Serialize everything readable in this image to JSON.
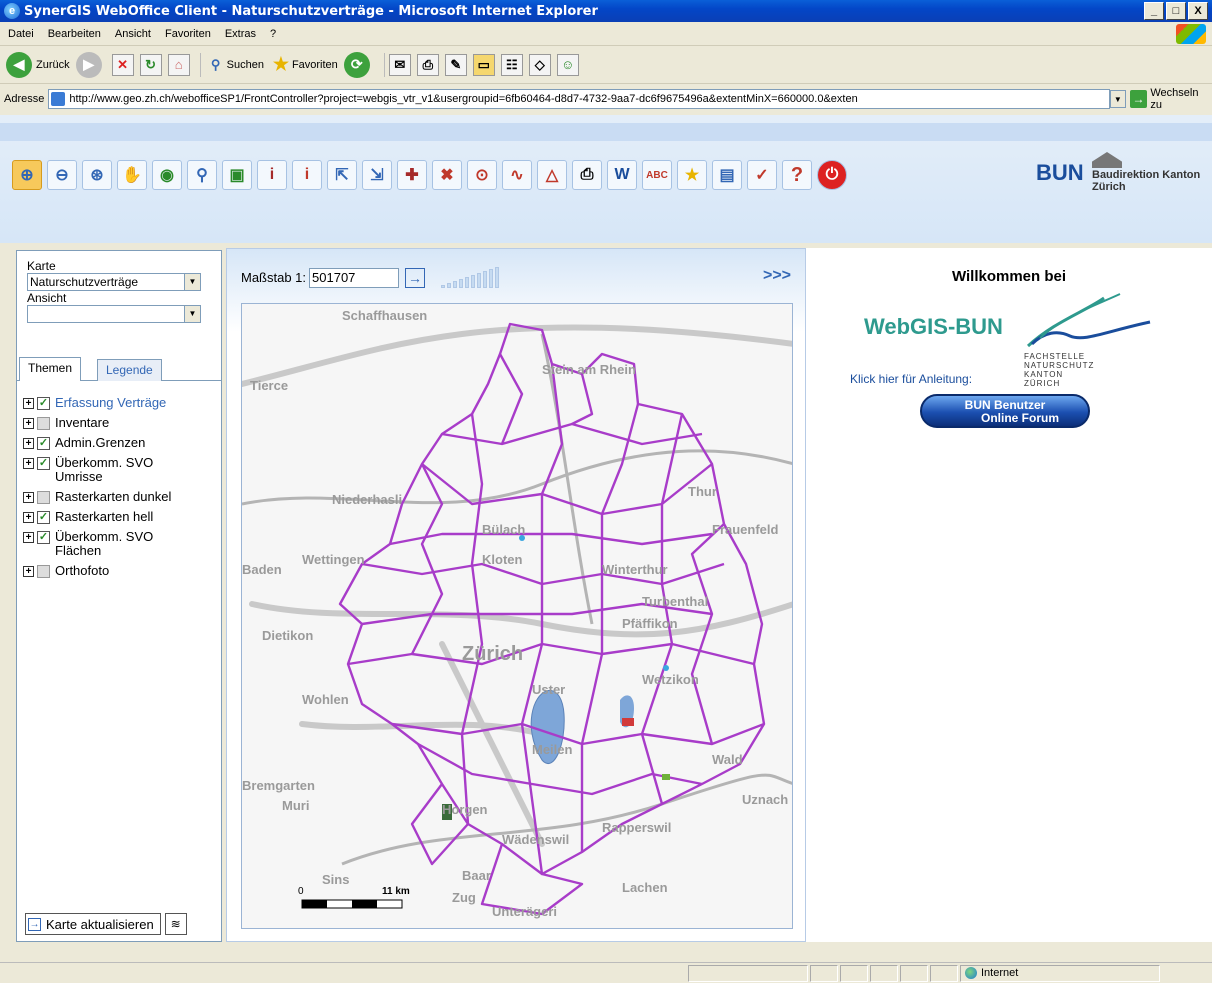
{
  "window": {
    "title": "SynerGIS WebOffice Client - Naturschutzverträge - Microsoft Internet Explorer",
    "min": "_",
    "max": "□",
    "close": "X"
  },
  "menu": [
    "Datei",
    "Bearbeiten",
    "Ansicht",
    "Favoriten",
    "Extras",
    "?"
  ],
  "toolbar": {
    "back": "Zurück",
    "search": "Suchen",
    "favorites": "Favoriten"
  },
  "address": {
    "label": "Adresse",
    "url": "http://www.geo.zh.ch/webofficeSP1/FrontController?project=webgis_vtr_v1&usergroupid=6fb60464-d8d7-4732-9aa7-dc6f9675496a&extentMinX=660000.0&exten",
    "go": "Wechseln zu"
  },
  "app": {
    "bun": "BUN",
    "baudirektion": "Baudirektion Kanton Zürich"
  },
  "left": {
    "karte_label": "Karte",
    "karte_value": "Naturschutzverträge",
    "ansicht_label": "Ansicht",
    "ansicht_value": "",
    "tab_themen": "Themen",
    "tab_legende": "Legende",
    "themes": [
      {
        "label": "Erfassung Verträge",
        "checked": true
      },
      {
        "label": "Inventare",
        "checked": false
      },
      {
        "label": "Admin.Grenzen",
        "checked": true
      },
      {
        "label": "Überkomm. SVO Umrisse",
        "checked": true
      },
      {
        "label": "Rasterkarten dunkel",
        "checked": false
      },
      {
        "label": "Rasterkarten hell",
        "checked": true
      },
      {
        "label": "Überkomm. SVO Flächen",
        "checked": true
      },
      {
        "label": "Orthofoto",
        "checked": false
      }
    ],
    "refresh": "Karte aktualisieren"
  },
  "map": {
    "scale_label": "Maßstab 1:",
    "scale_value": "501707",
    "more": ">>>",
    "places": [
      "Schaffhausen",
      "Stein am Rhein",
      "Tierce",
      "Frauenfeld",
      "Niederhasli",
      "Bülach",
      "Winterthur",
      "Baden",
      "Wettingen",
      "Kloten",
      "Dietikon",
      "Zürich",
      "Wohlen",
      "Uster",
      "Wetzikon",
      "Meilen",
      "Bremgarten",
      "Muri",
      "Horgen",
      "Wädenswil",
      "Rapperswil",
      "Sins",
      "Baar",
      "Zug",
      "Lachen",
      "Unterägeri",
      "Muri",
      "Turbenthal",
      "Pfäffikon",
      "Thur",
      "Wald",
      "Uznach"
    ],
    "scale_km": "11 km",
    "scale_zero": "0"
  },
  "right": {
    "welcome": "Willkommen bei",
    "webgis": "WebGIS-BUN",
    "fach": "FACHSTELLE NATURSCHUTZ KANTON ZÜRICH",
    "anleitung": "Klick hier für Anleitung:",
    "forum1": "BUN Benutzer",
    "forum2": "Online Forum"
  },
  "status": {
    "zone": "Internet"
  }
}
